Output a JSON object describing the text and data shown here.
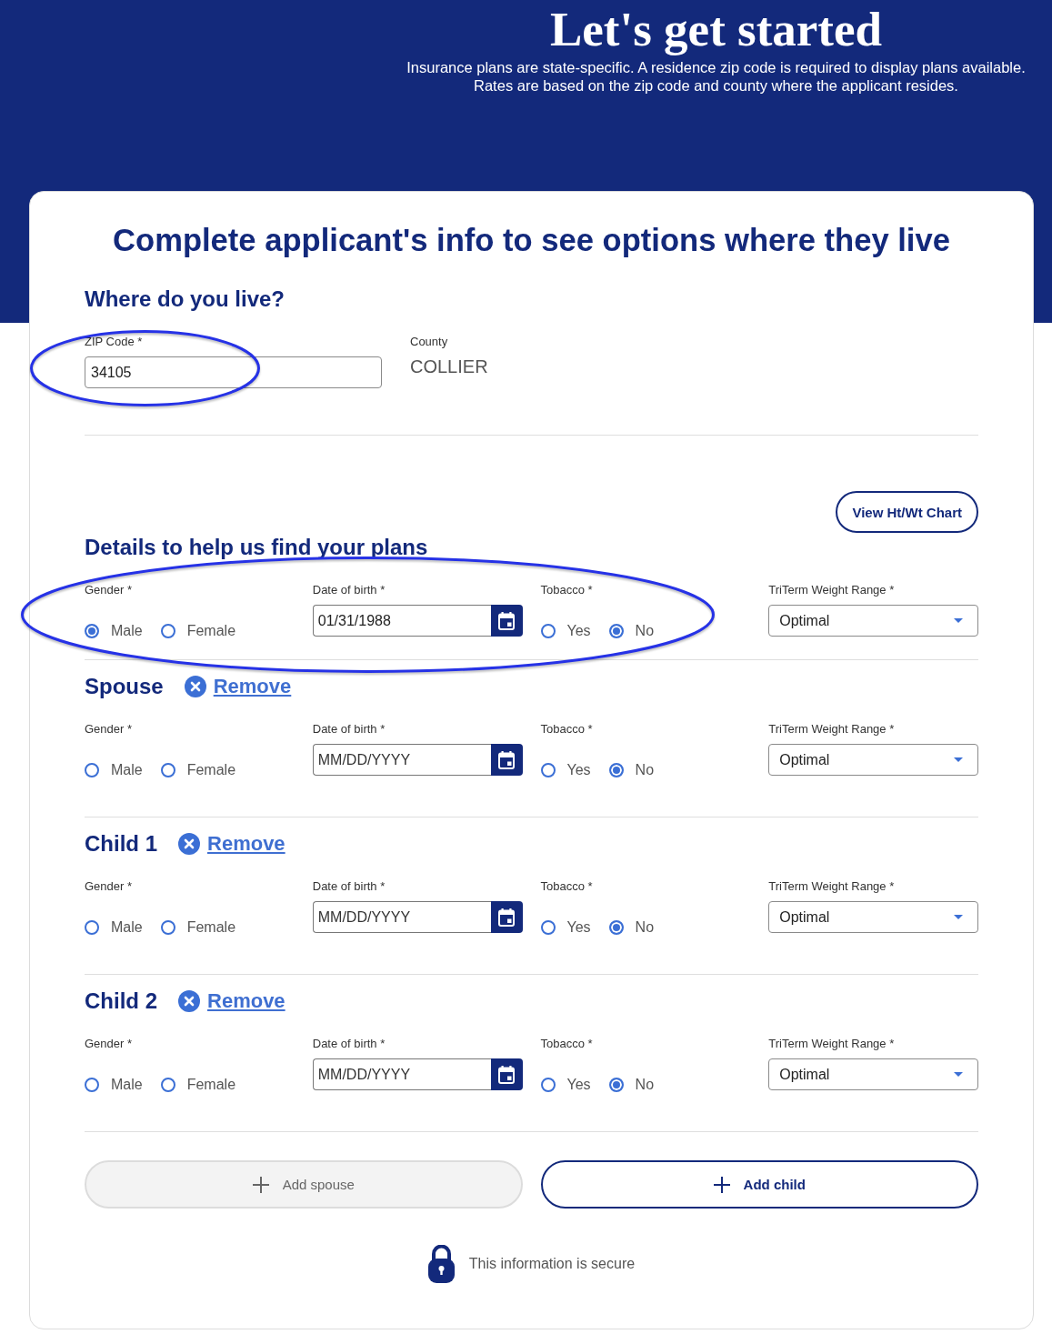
{
  "header": {
    "title": "Let's get started",
    "subtitle_lines": [
      "Insurance plans are state-specific. A residence zip code is required to display plans available.",
      "Rates are based on the zip code and county where the applicant resides."
    ]
  },
  "card": {
    "title": "Complete applicant's info to see options where they live"
  },
  "residence": {
    "heading": "Where do you live?",
    "zip": {
      "label": "ZIP Code *",
      "value": "34105",
      "circled": true
    },
    "county": {
      "label": "County",
      "value": "COLLIER"
    }
  },
  "details": {
    "heading": "Details to help us find your plans",
    "chart_button": "View Ht/Wt Chart"
  },
  "applicants": [
    {
      "circled": true,
      "gender": {
        "label": "Gender *",
        "options": [
          {
            "label": "Male",
            "selected": true
          },
          {
            "label": "Female",
            "selected": false
          }
        ]
      },
      "dob": {
        "label": "Date of birth *",
        "value": "01/31/1988"
      },
      "tobacco": {
        "label": "Tobacco *",
        "options": [
          {
            "label": "Yes",
            "selected": false
          },
          {
            "label": "No",
            "selected": true
          }
        ]
      },
      "weight": {
        "label": "TriTerm Weight Range *",
        "value": "Optimal"
      }
    },
    {
      "heading": "Spouse",
      "remove": "Remove",
      "circled": false,
      "gender": {
        "label": "Gender *",
        "options": [
          {
            "label": "Male",
            "selected": false
          },
          {
            "label": "Female",
            "selected": false
          }
        ]
      },
      "dob": {
        "label": "Date of birth *",
        "placeholder": "MM/DD/YYYY"
      },
      "tobacco": {
        "label": "Tobacco *",
        "options": [
          {
            "label": "Yes",
            "selected": false
          },
          {
            "label": "No",
            "selected": true
          }
        ]
      },
      "weight": {
        "label": "TriTerm Weight Range *",
        "value": "Optimal"
      }
    },
    {
      "heading": "Child 1",
      "remove": "Remove",
      "circled": false,
      "gender": {
        "label": "Gender *",
        "options": [
          {
            "label": "Male",
            "selected": false
          },
          {
            "label": "Female",
            "selected": false
          }
        ]
      },
      "dob": {
        "label": "Date of birth *",
        "placeholder": "MM/DD/YYYY"
      },
      "tobacco": {
        "label": "Tobacco *",
        "options": [
          {
            "label": "Yes",
            "selected": false
          },
          {
            "label": "No",
            "selected": true
          }
        ]
      },
      "weight": {
        "label": "TriTerm Weight Range *",
        "value": "Optimal"
      }
    },
    {
      "heading": "Child 2",
      "remove": "Remove",
      "circled": false,
      "gender": {
        "label": "Gender *",
        "options": [
          {
            "label": "Male",
            "selected": false
          },
          {
            "label": "Female",
            "selected": false
          }
        ]
      },
      "dob": {
        "label": "Date of birth *",
        "placeholder": "MM/DD/YYYY"
      },
      "tobacco": {
        "label": "Tobacco *",
        "options": [
          {
            "label": "Yes",
            "selected": false
          },
          {
            "label": "No",
            "selected": true
          }
        ]
      },
      "weight": {
        "label": "TriTerm Weight Range *",
        "value": "Optimal"
      }
    }
  ],
  "add_buttons": [
    {
      "label": "Add spouse",
      "disabled": true
    },
    {
      "label": "Add child",
      "disabled": false
    }
  ],
  "secure_note": "This information is secure"
}
